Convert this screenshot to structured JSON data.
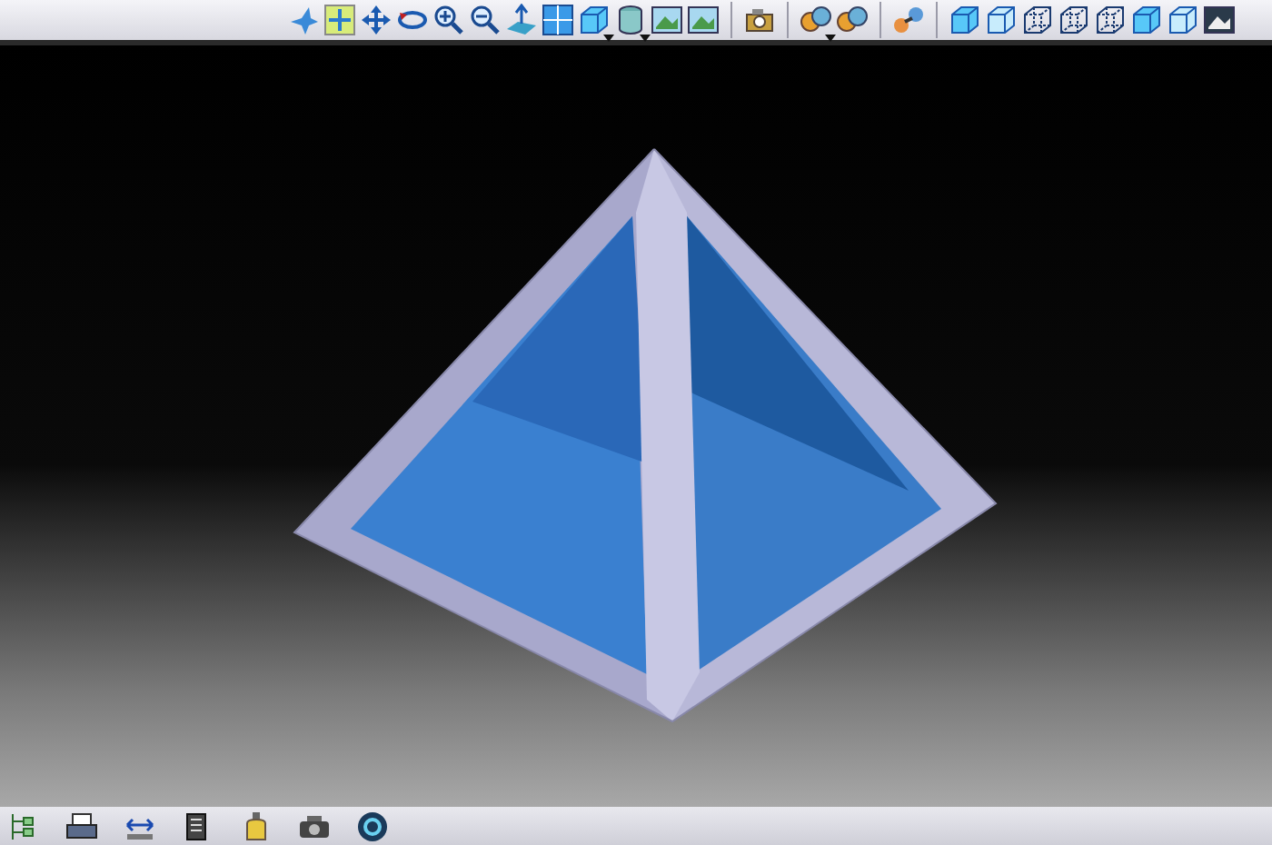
{
  "top_toolbar": {
    "groups": [
      [
        {
          "kind": "fly"
        },
        {
          "kind": "fit-all"
        },
        {
          "kind": "pan"
        },
        {
          "kind": "rotate"
        },
        {
          "kind": "zoom-in"
        },
        {
          "kind": "zoom-out"
        },
        {
          "kind": "normal-view"
        },
        {
          "kind": "multi-view"
        },
        {
          "kind": "iso-view",
          "dropdown": true
        },
        {
          "kind": "shading",
          "dropdown": true
        },
        {
          "kind": "hide-show"
        },
        {
          "kind": "swap-space"
        }
      ],
      [
        {
          "kind": "cameras"
        }
      ],
      [
        {
          "kind": "lights",
          "dropdown": true
        },
        {
          "kind": "materials"
        }
      ],
      [
        {
          "kind": "link"
        }
      ],
      [
        {
          "kind": "cube-solid"
        },
        {
          "kind": "cube-edges"
        },
        {
          "kind": "cube-wire"
        },
        {
          "kind": "cube-wire"
        },
        {
          "kind": "cube-wire"
        },
        {
          "kind": "cube-solid"
        },
        {
          "kind": "cube-edges"
        },
        {
          "kind": "image"
        }
      ]
    ]
  },
  "bottom_toolbar": {
    "items": [
      {
        "kind": "tree"
      },
      {
        "kind": "printer"
      },
      {
        "kind": "measure"
      },
      {
        "kind": "document"
      },
      {
        "kind": "bottle"
      },
      {
        "kind": "camera"
      },
      {
        "kind": "refresh"
      }
    ]
  }
}
